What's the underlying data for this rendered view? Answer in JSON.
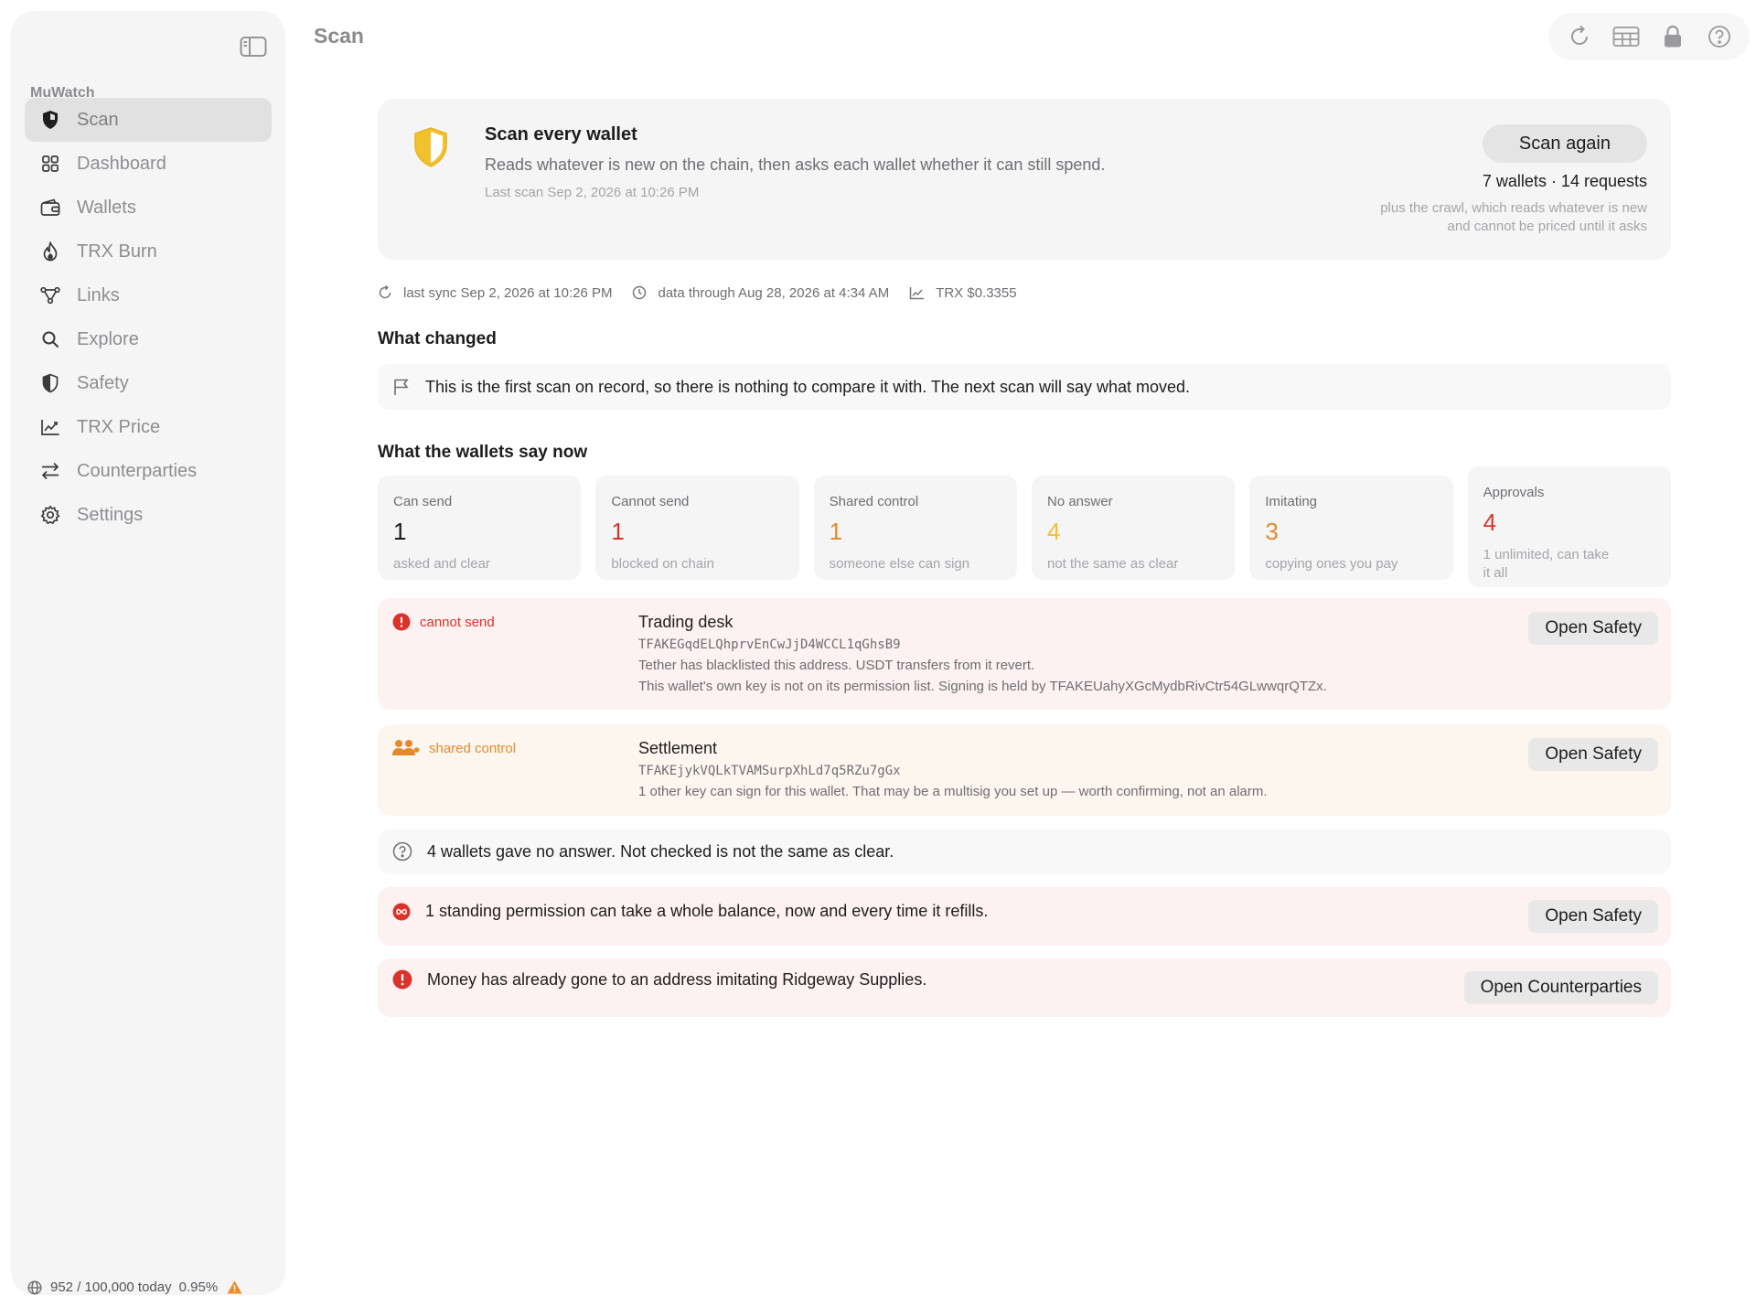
{
  "app": {
    "name": "MuWatch",
    "page_title": "Scan"
  },
  "sidebar": {
    "section_label": "MuWatch",
    "items": [
      {
        "label": "Scan",
        "icon": "shield-icon",
        "active": true
      },
      {
        "label": "Dashboard",
        "icon": "grid-icon"
      },
      {
        "label": "Wallets",
        "icon": "wallet-icon"
      },
      {
        "label": "TRX Burn",
        "icon": "flame-icon"
      },
      {
        "label": "Links",
        "icon": "nodes-icon"
      },
      {
        "label": "Explore",
        "icon": "search-icon"
      },
      {
        "label": "Safety",
        "icon": "half-shield-icon"
      },
      {
        "label": "TRX Price",
        "icon": "chart-icon"
      },
      {
        "label": "Counterparties",
        "icon": "arrows-icon"
      },
      {
        "label": "Settings",
        "icon": "gear-icon"
      }
    ],
    "footer": {
      "usage": "952 / 100,000 today",
      "percent": "0.95%"
    }
  },
  "toolbar": {
    "buttons": [
      "refresh-icon",
      "table-icon",
      "lock-icon",
      "help-icon"
    ]
  },
  "hero": {
    "title": "Scan every wallet",
    "description": "Reads whatever is new on the chain, then asks each wallet whether it can still spend.",
    "last_scan": "Last scan Sep 2, 2026 at 10:26 PM",
    "button_label": "Scan again",
    "counts": "7 wallets · 14 requests",
    "note_line1": "plus the crawl, which reads whatever is new",
    "note_line2": "and cannot be priced until it asks"
  },
  "sync": {
    "last_sync": "last sync Sep 2, 2026 at 10:26 PM",
    "data_through": "data through Aug 28, 2026 at 4:34 AM",
    "price": "TRX $0.3355"
  },
  "changed": {
    "title": "What changed",
    "text": "This is the first scan on record, so there is nothing to compare it with. The next scan will say what moved."
  },
  "now": {
    "title": "What the wallets say now",
    "stats": [
      {
        "label": "Can send",
        "value": "1",
        "sub": "asked and clear",
        "color": "#1d1d1f"
      },
      {
        "label": "Cannot send",
        "value": "1",
        "sub": "blocked on chain",
        "color": "#d9342b"
      },
      {
        "label": "Shared control",
        "value": "1",
        "sub": "someone else can sign",
        "color": "#e58a2b"
      },
      {
        "label": "No answer",
        "value": "4",
        "sub": "not the same as clear",
        "color": "#f2c12e"
      },
      {
        "label": "Imitating",
        "value": "3",
        "sub": "copying ones you pay",
        "color": "#e58a2b"
      },
      {
        "label": "Approvals",
        "value": "4",
        "sub_line1": "1 unlimited, can take",
        "sub_line2": "it all",
        "color": "#d9342b"
      }
    ]
  },
  "alerts": {
    "trading": {
      "tag": "cannot send",
      "name": "Trading desk",
      "address": "TFAKEGqdELQhprvEnCwJjD4WCCL1qGhsB9",
      "line1": "Tether has blacklisted this address. USDT transfers from it revert.",
      "line2": "This wallet's own key is not on its permission list. Signing is held by TFAKEUahyXGcMydbRivCtr54GLwwqrQTZx.",
      "button": "Open Safety"
    },
    "settlement": {
      "tag": "shared control",
      "name": "Settlement",
      "address": "TFAKEjykVQLkTVAMSurpXhLd7q5RZu7gGx",
      "line1": "1 other key can sign for this wallet. That may be a multisig you set up — worth confirming, not an alarm.",
      "button": "Open Safety"
    },
    "no_answer": {
      "text": "4 wallets gave no answer. Not checked is not the same as clear."
    },
    "permission": {
      "text": "1 standing permission can take a whole balance, now and every time it refills.",
      "button": "Open Safety"
    },
    "imitation": {
      "text": "Money has already gone to an address imitating Ridgeway Supplies.",
      "button": "Open Counterparties"
    }
  },
  "colors": {
    "red": "#d9342b",
    "orange": "#e58a2b",
    "yellow": "#f2c12e"
  }
}
